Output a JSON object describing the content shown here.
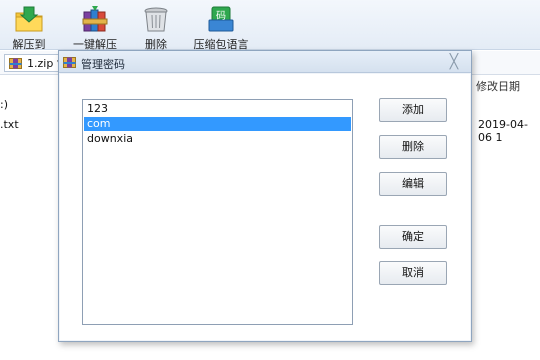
{
  "toolbar": {
    "extract_label": "解压到",
    "oneclick_label": "一键解压",
    "delete_label": "删除",
    "compress_label": "压缩包语言",
    "compress_icon_text": "码"
  },
  "address": {
    "file_name": "1.zip",
    "dropdown_glyph": "▾"
  },
  "file_list": {
    "modified_header": "修改日期",
    "rows": [
      {
        "name": ":)",
        "date": ""
      },
      {
        "name": ".txt",
        "date": "2019-04-06 1"
      }
    ]
  },
  "dialog": {
    "title": "管理密码",
    "close_glyph": "╳",
    "passwords": [
      "123",
      "com",
      "downxia"
    ],
    "selected_index": 1,
    "buttons": {
      "add": "添加",
      "delete": "删除",
      "edit": "编辑",
      "ok": "确定",
      "cancel": "取消"
    }
  },
  "colors": {
    "selection": "#3399ff",
    "accent_green": "#2fa84f",
    "folder_yellow": "#f3c53b"
  }
}
